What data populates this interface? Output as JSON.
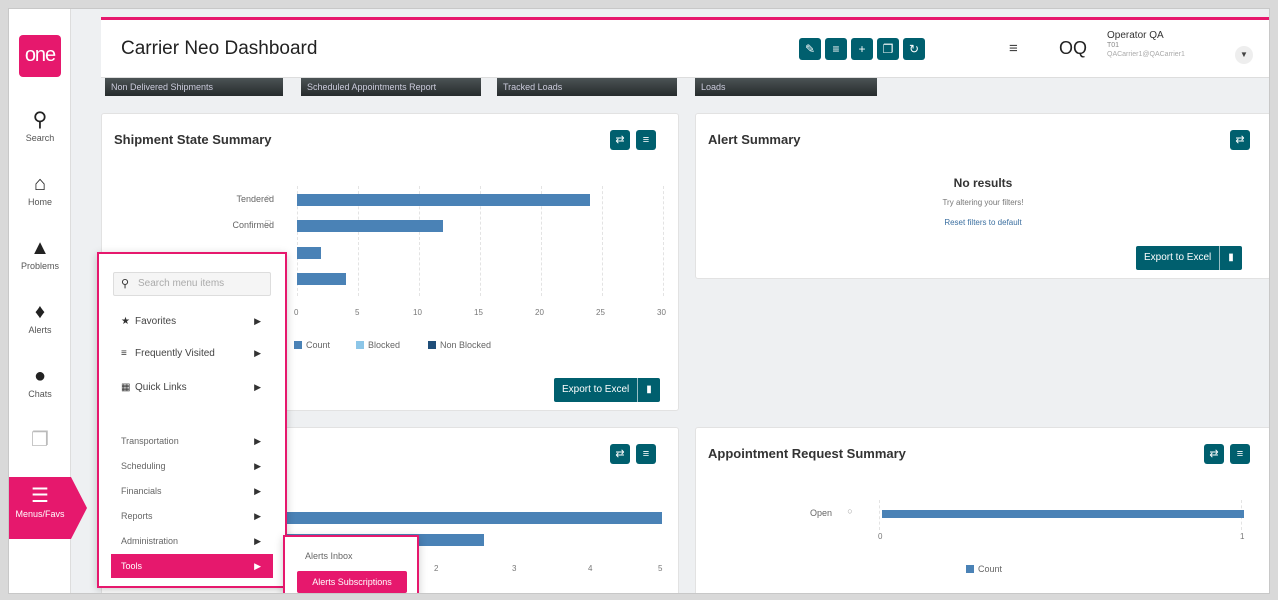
{
  "logo": "one",
  "nav": [
    {
      "label": "Search",
      "icon": "search-icon"
    },
    {
      "label": "Home",
      "icon": "home-icon"
    },
    {
      "label": "Problems",
      "icon": "warning-icon"
    },
    {
      "label": "Alerts",
      "icon": "bell-icon"
    },
    {
      "label": "Chats",
      "icon": "chat-icon"
    },
    {
      "label": "",
      "icon": "copy-icon"
    },
    {
      "label": "Menus/Favs",
      "icon": "menu-icon"
    }
  ],
  "header": {
    "title": "Carrier Neo Dashboard",
    "user_initials": "OQ",
    "user_name": "Operator QA",
    "user_org": "T01",
    "user_email": "QACarrier1@QACarrier1"
  },
  "tiles": [
    "Non Delivered Shipments",
    "Scheduled Appointments Report",
    "Tracked Loads",
    "Loads"
  ],
  "shipment_widget": {
    "title": "Shipment State Summary",
    "export_label": "Export to Excel"
  },
  "alert_widget": {
    "title": "Alert Summary",
    "no_results": "No results",
    "hint": "Try altering your filters!",
    "reset": "Reset filters to default",
    "export_label": "Export to Excel"
  },
  "appointment_widget": {
    "title": "Appointment Request Summary"
  },
  "menu": {
    "search_placeholder": "Search menu items",
    "items": [
      "Favorites",
      "Frequently Visited",
      "Quick Links"
    ],
    "sections": [
      "Transportation",
      "Scheduling",
      "Financials",
      "Reports",
      "Administration"
    ],
    "tools": "Tools"
  },
  "submenu": {
    "inbox": "Alerts Inbox",
    "subscriptions": "Alerts Subscriptions"
  },
  "colors": {
    "accent": "#e6186d",
    "teal": "#005f6e",
    "bar": "#4a82b6",
    "light_bar": "#8cc6e8",
    "dark_bar": "#1f4e79"
  },
  "chart_data": [
    {
      "type": "bar",
      "title": "Shipment State Summary",
      "orientation": "horizontal",
      "categories": [
        "Tendered",
        "Confirmed",
        "",
        ""
      ],
      "series": [
        {
          "name": "Count",
          "values": [
            24,
            12,
            2,
            4
          ]
        }
      ],
      "legend": [
        "Count",
        "Blocked",
        "Non Blocked"
      ],
      "xticks": [
        "0",
        "5",
        "10",
        "15",
        "20",
        "25",
        "30"
      ],
      "xlim": [
        0,
        30
      ]
    },
    {
      "type": "bar",
      "orientation": "horizontal",
      "categories": [
        "",
        ""
      ],
      "series": [
        {
          "name": "",
          "values": [
            5,
            3
          ]
        }
      ],
      "xticks": [
        "2",
        "3",
        "4",
        "5"
      ],
      "xlim": [
        0,
        5
      ]
    },
    {
      "type": "bar",
      "title": "Appointment Request Summary",
      "orientation": "horizontal",
      "categories": [
        "Open"
      ],
      "series": [
        {
          "name": "Count",
          "values": [
            1
          ]
        }
      ],
      "legend": [
        "Count"
      ],
      "xticks": [
        "0",
        "1"
      ],
      "xlim": [
        0,
        1
      ]
    }
  ]
}
